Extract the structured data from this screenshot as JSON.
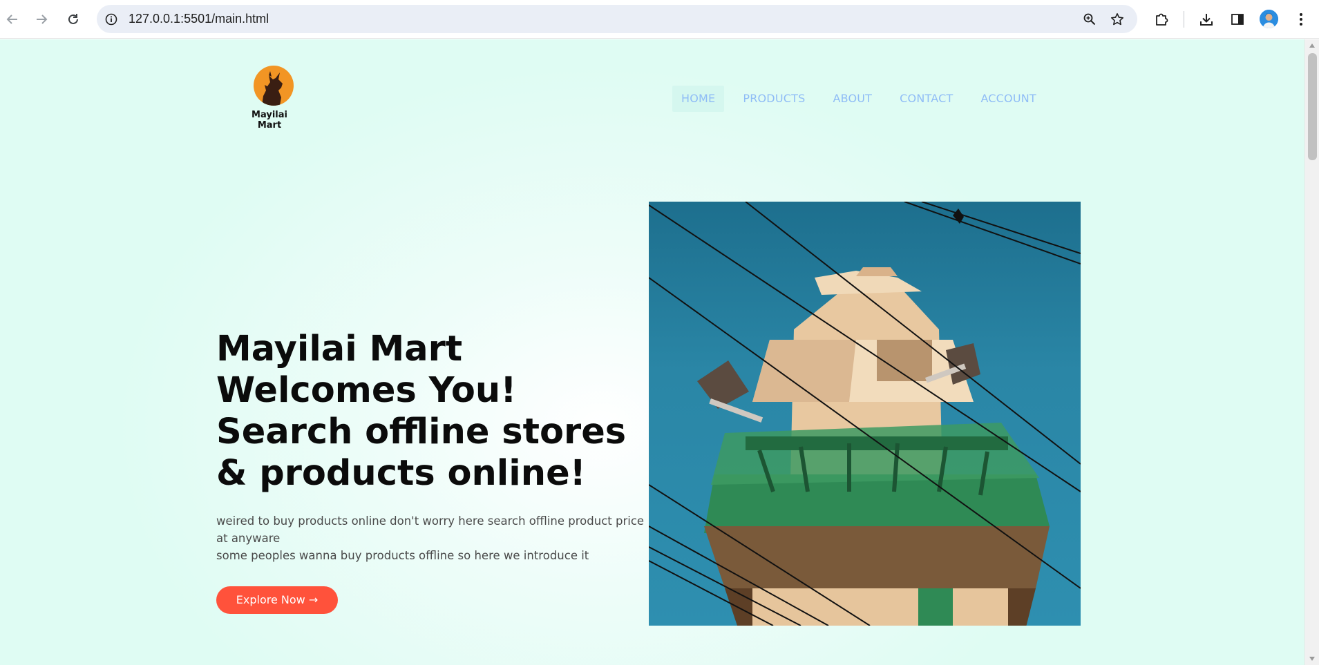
{
  "browser": {
    "url": "127.0.0.1:5501/main.html",
    "back_icon": "arrow-left-icon",
    "forward_icon": "arrow-right-icon",
    "reload_icon": "reload-icon",
    "site_info_icon": "info-icon",
    "zoom_icon": "zoom-icon",
    "bookmark_icon": "star-icon",
    "extensions_icon": "puzzle-icon",
    "download_icon": "download-icon",
    "sidepanel_icon": "side-panel-icon",
    "menu_icon": "kebab-menu-icon"
  },
  "site": {
    "logo_text": "Mayilai Mart",
    "nav": [
      {
        "label": "HOME",
        "active": true
      },
      {
        "label": "PRODUCTS",
        "active": false
      },
      {
        "label": "ABOUT",
        "active": false
      },
      {
        "label": "CONTACT",
        "active": false
      },
      {
        "label": "ACCOUNT",
        "active": false
      }
    ],
    "hero": {
      "title_line1": "Mayilai Mart Welcomes You!",
      "title_line2": "Search offline stores & products online!",
      "desc_line1": "weired to buy products online don't worry here search offline product price at anyware",
      "desc_line2": "some peoples wanna buy products offline so here we introduce it",
      "button_label": "Explore Now →"
    }
  },
  "colors": {
    "accent": "#ff523b",
    "nav_text": "#8fbcf6",
    "page_bg": "#dffcf3",
    "logo_orange": "#f29524"
  }
}
